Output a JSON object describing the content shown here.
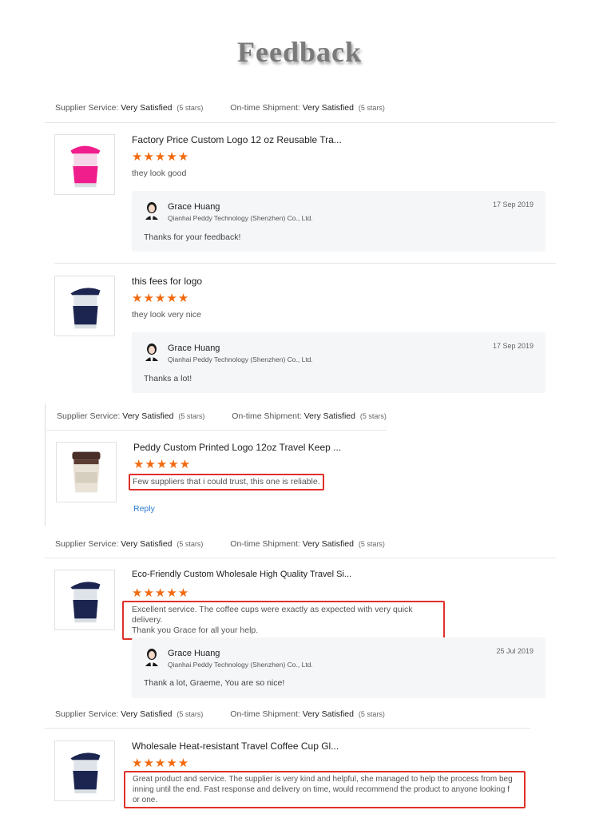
{
  "title": "Feedback",
  "labels": {
    "supplier_service": "Supplier Service:",
    "on_time_shipment": "On-time Shipment:",
    "very_satisfied": "Very Satisfied",
    "five_stars": "(5 stars)",
    "stars_glyph": "★★★★★"
  },
  "colors": {
    "star": "#f26a10",
    "highlight": "#e0302b",
    "reply_link": "#2a7bd3",
    "pink_cup": "#f01e8c",
    "navy_cup": "#1b2550",
    "brown_lid": "#4a2f28"
  },
  "reviews": [
    {
      "product": "Factory Price Custom Logo 12 oz Reusable Tra...",
      "rating": 5,
      "comment": "they look good",
      "reply": {
        "name": "Grace Huang",
        "company": "Qianhai Peddy Technology (Shenzhen) Co., Ltd.",
        "date": "17 Sep 2019",
        "message": "Thanks for your feedback!"
      }
    },
    {
      "product": "this fees for logo",
      "rating": 5,
      "comment": "they look very nice",
      "reply": {
        "name": "Grace Huang",
        "company": "Qianhai Peddy Technology (Shenzhen) Co., Ltd.",
        "date": "17 Sep 2019",
        "message": "Thanks a lot!"
      }
    },
    {
      "product": "Peddy Custom Printed Logo 12oz Travel Keep ...",
      "rating": 5,
      "comment": "Few suppliers that i could trust, this one is reliable.",
      "reply_link": "Reply"
    },
    {
      "product": "Eco-Friendly Custom Wholesale High Quality Travel Si...",
      "rating": 5,
      "comment_line1": "Excellent service. The coffee cups were exactly as expected with very quick delivery.",
      "comment_line2": "Thank you Grace for all your help.",
      "reply": {
        "name": "Grace Huang",
        "company": "Qianhai Peddy Technology (Shenzhen) Co., Ltd.",
        "date": "25 Jul 2019",
        "message": "Thank a lot, Graeme, You are so nice!"
      }
    },
    {
      "product": "Wholesale Heat-resistant Travel Coffee Cup Gl...",
      "rating": 5,
      "comment_line1": "Great product and service. The supplier is very kind and helpful, she managed to help the process from beg",
      "comment_line2": "inning until the end. Fast response and delivery on time, would recommend the product to anyone looking f",
      "comment_line3": "or one."
    }
  ]
}
